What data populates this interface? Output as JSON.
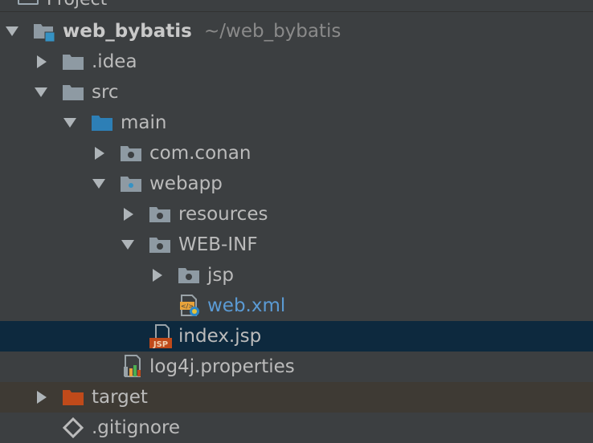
{
  "panel": {
    "title": "Project"
  },
  "tree": {
    "root": {
      "label": "web_bybatis",
      "path": "~/web_bybatis"
    },
    "idea": {
      "label": ".idea"
    },
    "src": {
      "label": "src"
    },
    "main": {
      "label": "main"
    },
    "com_conan": {
      "label": "com.conan"
    },
    "webapp": {
      "label": "webapp"
    },
    "resources": {
      "label": "resources"
    },
    "web_inf": {
      "label": "WEB-INF"
    },
    "jsp": {
      "label": "jsp"
    },
    "web_xml": {
      "label": "web.xml"
    },
    "index_jsp": {
      "label": "index.jsp",
      "icon_text": "JSP"
    },
    "log4j": {
      "label": "log4j.properties"
    },
    "target": {
      "label": "target"
    },
    "gitignore": {
      "label": ".gitignore"
    }
  },
  "colors": {
    "background": "#3c3f41",
    "selected_row": "#0d293e",
    "excluded_row": "#3e3a34",
    "text": "#bbbbbb",
    "path_text": "#8a8a8a",
    "xml_text": "#5b9bd5",
    "folder_gray": "#8e9aa3",
    "folder_blue": "#2d7fb6",
    "folder_orange": "#c04a1a"
  }
}
